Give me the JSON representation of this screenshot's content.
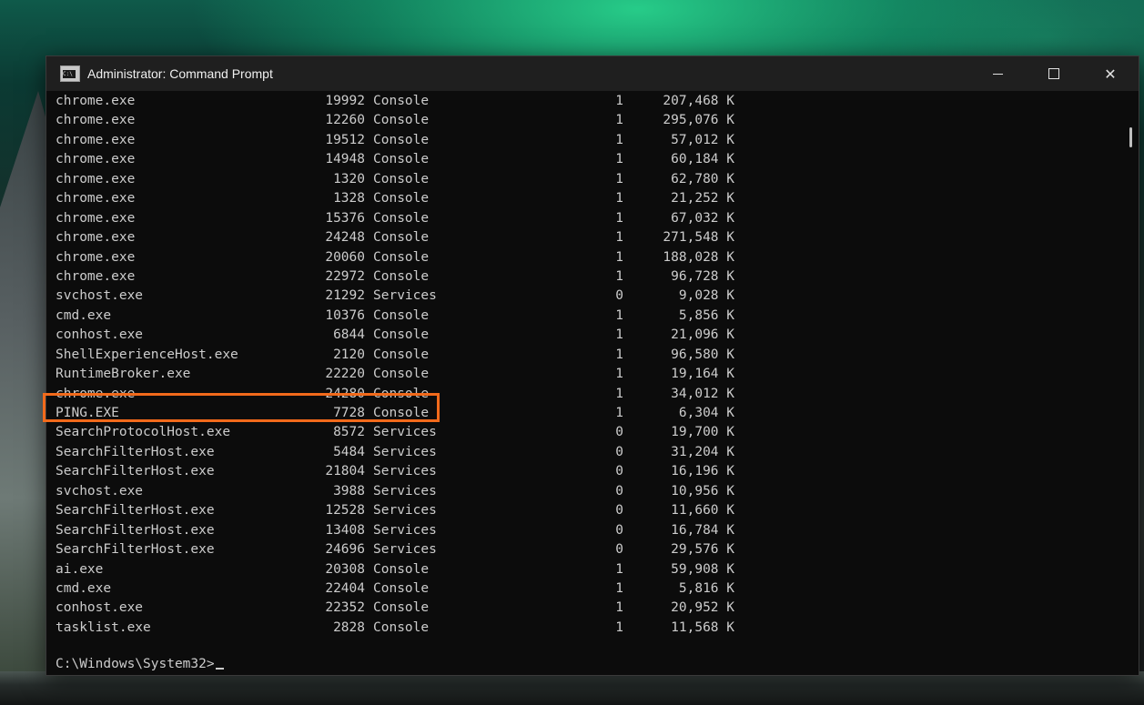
{
  "window": {
    "title": "Administrator: Command Prompt",
    "icon": "cmd-console-icon",
    "icon_text": "C:\\",
    "controls": {
      "minimize": "minimize-icon",
      "maximize": "maximize-icon",
      "close_glyph": "✕"
    }
  },
  "processes": [
    {
      "name": "chrome.exe",
      "pid": "19992",
      "session": "Console",
      "num": "1",
      "mem": "207,468 K"
    },
    {
      "name": "chrome.exe",
      "pid": "12260",
      "session": "Console",
      "num": "1",
      "mem": "295,076 K"
    },
    {
      "name": "chrome.exe",
      "pid": "19512",
      "session": "Console",
      "num": "1",
      "mem": "57,012 K"
    },
    {
      "name": "chrome.exe",
      "pid": "14948",
      "session": "Console",
      "num": "1",
      "mem": "60,184 K"
    },
    {
      "name": "chrome.exe",
      "pid": "1320",
      "session": "Console",
      "num": "1",
      "mem": "62,780 K"
    },
    {
      "name": "chrome.exe",
      "pid": "1328",
      "session": "Console",
      "num": "1",
      "mem": "21,252 K"
    },
    {
      "name": "chrome.exe",
      "pid": "15376",
      "session": "Console",
      "num": "1",
      "mem": "67,032 K"
    },
    {
      "name": "chrome.exe",
      "pid": "24248",
      "session": "Console",
      "num": "1",
      "mem": "271,548 K"
    },
    {
      "name": "chrome.exe",
      "pid": "20060",
      "session": "Console",
      "num": "1",
      "mem": "188,028 K"
    },
    {
      "name": "chrome.exe",
      "pid": "22972",
      "session": "Console",
      "num": "1",
      "mem": "96,728 K"
    },
    {
      "name": "svchost.exe",
      "pid": "21292",
      "session": "Services",
      "num": "0",
      "mem": "9,028 K"
    },
    {
      "name": "cmd.exe",
      "pid": "10376",
      "session": "Console",
      "num": "1",
      "mem": "5,856 K"
    },
    {
      "name": "conhost.exe",
      "pid": "6844",
      "session": "Console",
      "num": "1",
      "mem": "21,096 K"
    },
    {
      "name": "ShellExperienceHost.exe",
      "pid": "2120",
      "session": "Console",
      "num": "1",
      "mem": "96,580 K"
    },
    {
      "name": "RuntimeBroker.exe",
      "pid": "22220",
      "session": "Console",
      "num": "1",
      "mem": "19,164 K"
    },
    {
      "name": "chrome.exe",
      "pid": "24280",
      "session": "Console",
      "num": "1",
      "mem": "34,012 K"
    },
    {
      "name": "PING.EXE",
      "pid": "7728",
      "session": "Console",
      "num": "1",
      "mem": "6,304 K"
    },
    {
      "name": "SearchProtocolHost.exe",
      "pid": "8572",
      "session": "Services",
      "num": "0",
      "mem": "19,700 K"
    },
    {
      "name": "SearchFilterHost.exe",
      "pid": "5484",
      "session": "Services",
      "num": "0",
      "mem": "31,204 K"
    },
    {
      "name": "SearchFilterHost.exe",
      "pid": "21804",
      "session": "Services",
      "num": "0",
      "mem": "16,196 K"
    },
    {
      "name": "svchost.exe",
      "pid": "3988",
      "session": "Services",
      "num": "0",
      "mem": "10,956 K"
    },
    {
      "name": "SearchFilterHost.exe",
      "pid": "12528",
      "session": "Services",
      "num": "0",
      "mem": "11,660 K"
    },
    {
      "name": "SearchFilterHost.exe",
      "pid": "13408",
      "session": "Services",
      "num": "0",
      "mem": "16,784 K"
    },
    {
      "name": "SearchFilterHost.exe",
      "pid": "24696",
      "session": "Services",
      "num": "0",
      "mem": "29,576 K"
    },
    {
      "name": "ai.exe",
      "pid": "20308",
      "session": "Console",
      "num": "1",
      "mem": "59,908 K"
    },
    {
      "name": "cmd.exe",
      "pid": "22404",
      "session": "Console",
      "num": "1",
      "mem": "5,816 K"
    },
    {
      "name": "conhost.exe",
      "pid": "22352",
      "session": "Console",
      "num": "1",
      "mem": "20,952 K"
    },
    {
      "name": "tasklist.exe",
      "pid": "2828",
      "session": "Console",
      "num": "1",
      "mem": "11,568 K"
    }
  ],
  "prompt": "C:\\Windows\\System32>",
  "highlight": {
    "color": "#f26a1b",
    "target": "PING.EXE"
  },
  "colors": {
    "console_bg": "#0c0c0c",
    "console_fg": "#cccccc",
    "titlebar_bg": "#1f1f1f"
  }
}
